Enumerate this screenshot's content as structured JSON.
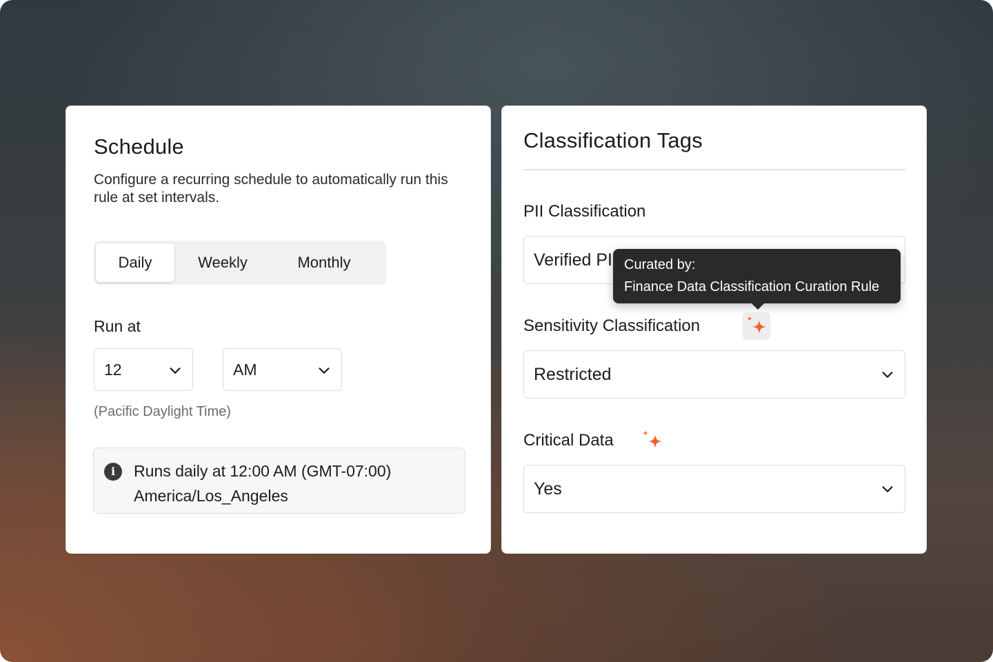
{
  "schedule": {
    "title": "Schedule",
    "description": "Configure a recurring schedule to automatically run this rule at set intervals.",
    "frequency_tabs": [
      {
        "label": "Daily",
        "active": true
      },
      {
        "label": "Weekly",
        "active": false
      },
      {
        "label": "Monthly",
        "active": false
      }
    ],
    "run_at_label": "Run at",
    "hour_value": "12",
    "meridiem_value": "AM",
    "timezone_hint": "(Pacific Daylight Time)",
    "summary_line1": "Runs daily at 12:00 AM (GMT-07:00)",
    "summary_line2": "America/Los_Angeles"
  },
  "classification": {
    "title": "Classification Tags",
    "pii_label": "PII Classification",
    "pii_value": "Verified PII",
    "sensitivity_label": "Sensitivity Classification",
    "sensitivity_value": "Restricted",
    "critical_label": "Critical Data",
    "critical_value": "Yes",
    "tooltip": {
      "line1": "Curated by:",
      "line2": "Finance Data Classification Curation Rule"
    }
  },
  "icons": {
    "dropdown": "chevron-down-icon",
    "info": "info-icon",
    "ai_curated": "sparkle-icon"
  },
  "colors": {
    "sparkle": "#f0622b",
    "tooltip_bg": "#2a2a2c"
  }
}
